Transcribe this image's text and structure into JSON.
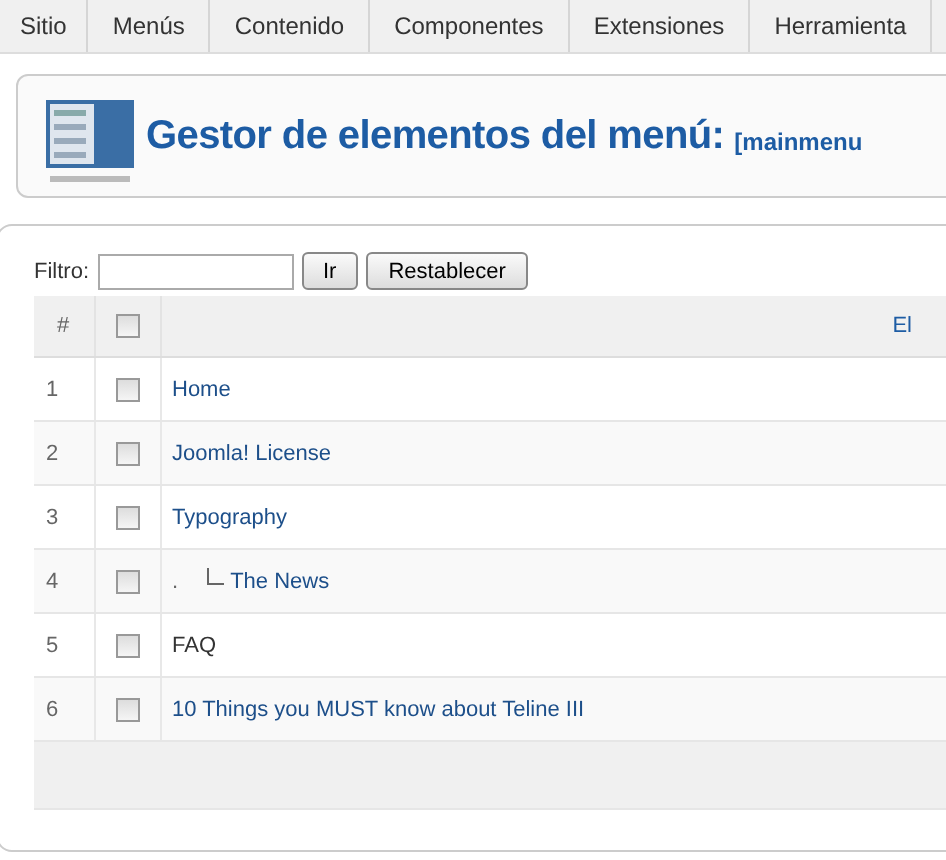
{
  "menu_bar": [
    {
      "label": "Sitio"
    },
    {
      "label": "Menús"
    },
    {
      "label": "Contenido"
    },
    {
      "label": "Componentes"
    },
    {
      "label": "Extensiones"
    },
    {
      "label": "Herramienta"
    }
  ],
  "header": {
    "title": "Gestor de elementos del menú:",
    "subtitle": "[mainmenu"
  },
  "filter": {
    "label": "Filtro:",
    "buttons": [
      "Ir",
      "Restablecer"
    ]
  },
  "table": {
    "columns": [
      "#",
      "El"
    ],
    "select_all": {
      "checked": false
    },
    "rows": [
      {
        "number": "1",
        "title": "Home",
        "linked": true,
        "checked": false
      },
      {
        "number": "2",
        "title": "Joomla! License",
        "linked": true,
        "checked": false
      },
      {
        "number": "3",
        "title": "Typography",
        "linked": true,
        "checked": false,
        "children": [
          {
            "number": "4",
            "marker": ".",
            "title": "The News",
            "linked": true,
            "checked": false
          }
        ]
      },
      {
        "number": "5",
        "title": "FAQ",
        "linked": false,
        "checked": false
      },
      {
        "number": "6",
        "title": "10 Things you MUST know about Teline III",
        "linked": true,
        "checked": false
      }
    ]
  }
}
